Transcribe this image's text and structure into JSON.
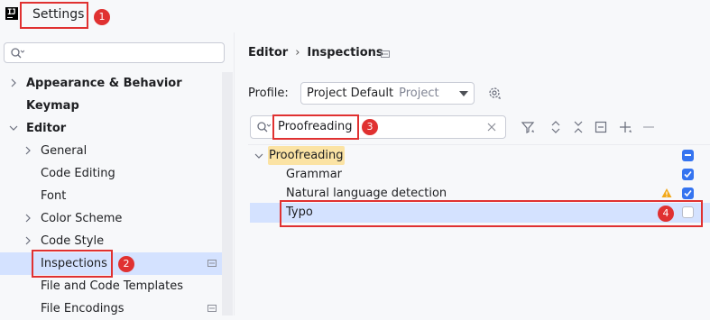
{
  "window": {
    "title": "Settings",
    "logo_text": "IJ"
  },
  "annotations": {
    "badge_1": "1",
    "badge_2": "2",
    "badge_3": "3",
    "badge_4": "4"
  },
  "sidebar": {
    "search": {
      "placeholder": "",
      "value": ""
    },
    "items": [
      {
        "label": "Appearance & Behavior",
        "bold": true,
        "expandable": true,
        "expanded": false
      },
      {
        "label": "Keymap",
        "bold": true
      },
      {
        "label": "Editor",
        "bold": true,
        "expandable": true,
        "expanded": true
      },
      {
        "label": "General",
        "expandable": true
      },
      {
        "label": "Code Editing"
      },
      {
        "label": "Font"
      },
      {
        "label": "Color Scheme",
        "expandable": true
      },
      {
        "label": "Code Style",
        "expandable": true
      },
      {
        "label": "Inspections",
        "selected": true
      },
      {
        "label": "File and Code Templates"
      },
      {
        "label": "File Encodings"
      }
    ]
  },
  "breadcrumb": {
    "parent": "Editor",
    "separator": "›",
    "current": "Inspections"
  },
  "profile": {
    "label": "Profile:",
    "value": "Project Default",
    "scope": "Project"
  },
  "inspection_search": {
    "value": "Proofreading"
  },
  "inspections_tree": {
    "group": {
      "label": "Proofreading",
      "state": "mixed"
    },
    "items": [
      {
        "label": "Grammar",
        "checked": true
      },
      {
        "label": "Natural language detection",
        "checked": true,
        "warning": true
      },
      {
        "label": "Typo",
        "checked": false,
        "selected": true
      }
    ]
  },
  "colors": {
    "accent": "#3574f0",
    "selection": "#d4e2ff",
    "annotation_red": "#e03131",
    "warning": "#f2a91a"
  }
}
